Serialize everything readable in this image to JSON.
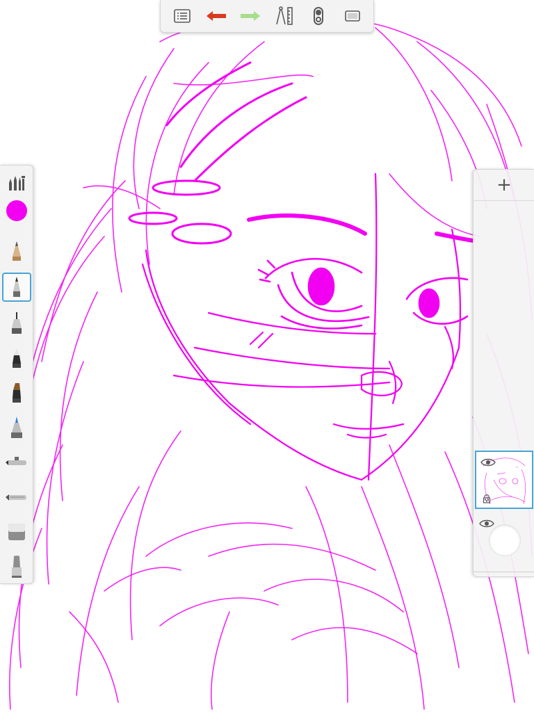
{
  "colors": {
    "ink": "#f200f2",
    "undo": "#d83a1e",
    "redo": "#a6de8c",
    "selection": "#4aa3d6",
    "icon": "#5a5a5a"
  },
  "toolbar": {
    "items": [
      {
        "icon": "list-icon"
      },
      {
        "icon": "undo-arrow-icon"
      },
      {
        "icon": "redo-arrow-icon"
      },
      {
        "icon": "ruler-compass-icon"
      },
      {
        "icon": "symmetry-icon"
      },
      {
        "icon": "fullscreen-icon"
      }
    ]
  },
  "palette": {
    "tools": [
      {
        "icon": "brush-library-icon"
      },
      {
        "icon": "color-swatch-icon",
        "color": "#f200f2"
      },
      {
        "icon": "pencil-icon"
      },
      {
        "icon": "ballpoint-pen-icon",
        "selected": true
      },
      {
        "icon": "technical-pen-icon"
      },
      {
        "icon": "marker-icon"
      },
      {
        "icon": "chisel-marker-icon"
      },
      {
        "icon": "paintbrush-icon"
      },
      {
        "icon": "airbrush-icon"
      },
      {
        "icon": "airbrush-soft-icon"
      },
      {
        "icon": "eraser-icon"
      },
      {
        "icon": "smudge-icon"
      }
    ]
  },
  "layers": {
    "add_label": "+",
    "items": [
      {
        "name": "sketch-layer",
        "visible": true,
        "active": true
      },
      {
        "name": "background-layer",
        "visible": true,
        "active": false
      }
    ]
  }
}
